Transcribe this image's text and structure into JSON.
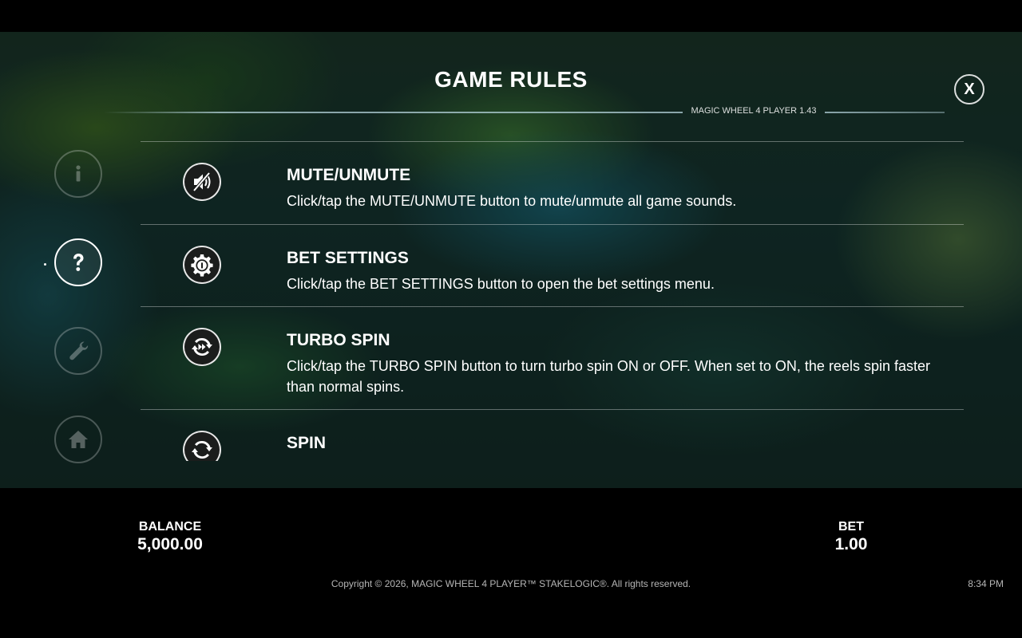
{
  "header": {
    "title": "GAME RULES",
    "version": "MAGIC WHEEL 4 PLAYER 1.43",
    "close_label": "X"
  },
  "side_nav": [
    {
      "name": "info",
      "icon": "info-icon",
      "active": false
    },
    {
      "name": "help",
      "icon": "question-icon",
      "active": true
    },
    {
      "name": "settings",
      "icon": "wrench-icon",
      "active": false
    },
    {
      "name": "home",
      "icon": "home-icon",
      "active": false
    }
  ],
  "rules": [
    {
      "icon": "mute-icon",
      "title": "MUTE/UNMUTE",
      "description": "Click/tap the MUTE/UNMUTE button to mute/unmute all game sounds."
    },
    {
      "icon": "bet-settings-icon",
      "title": "BET SETTINGS",
      "description": "Click/tap the BET SETTINGS button to open the bet settings menu."
    },
    {
      "icon": "turbo-spin-icon",
      "title": "TURBO SPIN",
      "description": "Click/tap the TURBO SPIN button to turn turbo spin ON or OFF. When set to ON, the reels spin faster than normal spins."
    },
    {
      "icon": "spin-icon",
      "title": "SPIN",
      "description": ""
    }
  ],
  "footer": {
    "balance_label": "BALANCE",
    "balance_value": "5,000.00",
    "bet_label": "BET",
    "bet_value": "1.00",
    "copyright": "Copyright © 2026, MAGIC WHEEL 4 PLAYER™ STAKELOGIC®. All rights reserved.",
    "clock": "8:34 PM"
  }
}
